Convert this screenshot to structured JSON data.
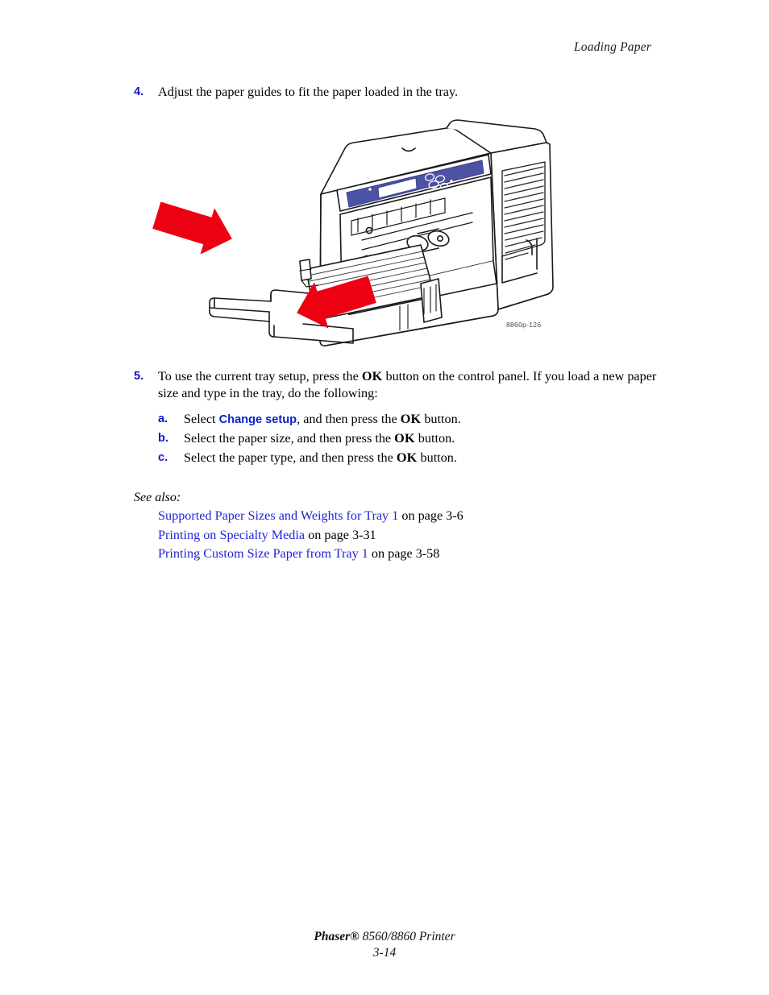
{
  "header": {
    "running_head": "Loading Paper"
  },
  "steps": [
    {
      "number": "4.",
      "text_parts": [
        {
          "t": "Adjust the paper guides to fit the paper loaded in the tray.",
          "style": "plain"
        }
      ]
    },
    {
      "number": "5.",
      "text_parts": [
        {
          "t": "To use the current tray setup, press the ",
          "style": "plain"
        },
        {
          "t": "OK",
          "style": "bold"
        },
        {
          "t": " button on the control panel. If you load a new paper size and type in the tray, do the following:",
          "style": "plain"
        }
      ]
    }
  ],
  "substeps": [
    {
      "letter": "a.",
      "parts": [
        {
          "t": "Select ",
          "style": "plain"
        },
        {
          "t": "Change setup",
          "style": "uiterm"
        },
        {
          "t": ", and then press the ",
          "style": "plain"
        },
        {
          "t": "OK",
          "style": "bold"
        },
        {
          "t": " button.",
          "style": "plain"
        }
      ]
    },
    {
      "letter": "b.",
      "parts": [
        {
          "t": "Select the paper size, and then press the ",
          "style": "plain"
        },
        {
          "t": "OK",
          "style": "bold"
        },
        {
          "t": " button.",
          "style": "plain"
        }
      ]
    },
    {
      "letter": "c.",
      "parts": [
        {
          "t": "Select the paper type, and then press the ",
          "style": "plain"
        },
        {
          "t": "OK",
          "style": "bold"
        },
        {
          "t": " button.",
          "style": "plain"
        }
      ]
    }
  ],
  "see_also": {
    "title": "See also:",
    "links": [
      {
        "label": "Supported Paper Sizes and Weights for Tray 1",
        "page": " on page 3-6"
      },
      {
        "label": "Printing on Specialty Media",
        "page": " on page 3-31"
      },
      {
        "label": "Printing Custom Size Paper from Tray 1",
        "page": " on page 3-58"
      }
    ]
  },
  "figure": {
    "id_label": "8860p-126",
    "alt": "Phaser 8560/8860 printer with Tray 1 open, red arrows indicating the paper guides being adjusted against the loaded paper stack",
    "colors": {
      "arrow_red": "#ee0013",
      "control_panel_blue": "#4c53a4",
      "outline": "#1a1a1a"
    }
  },
  "footer": {
    "brand": "Phaser®",
    "model": " 8560/8860 Printer",
    "page_number": "3-14"
  },
  "theme": {
    "link_blue": "#2222dd",
    "step_number_blue": "#1414cc",
    "ui_term_blue": "#0b1ecb",
    "text_black": "#000000",
    "page_background": "#ffffff"
  }
}
